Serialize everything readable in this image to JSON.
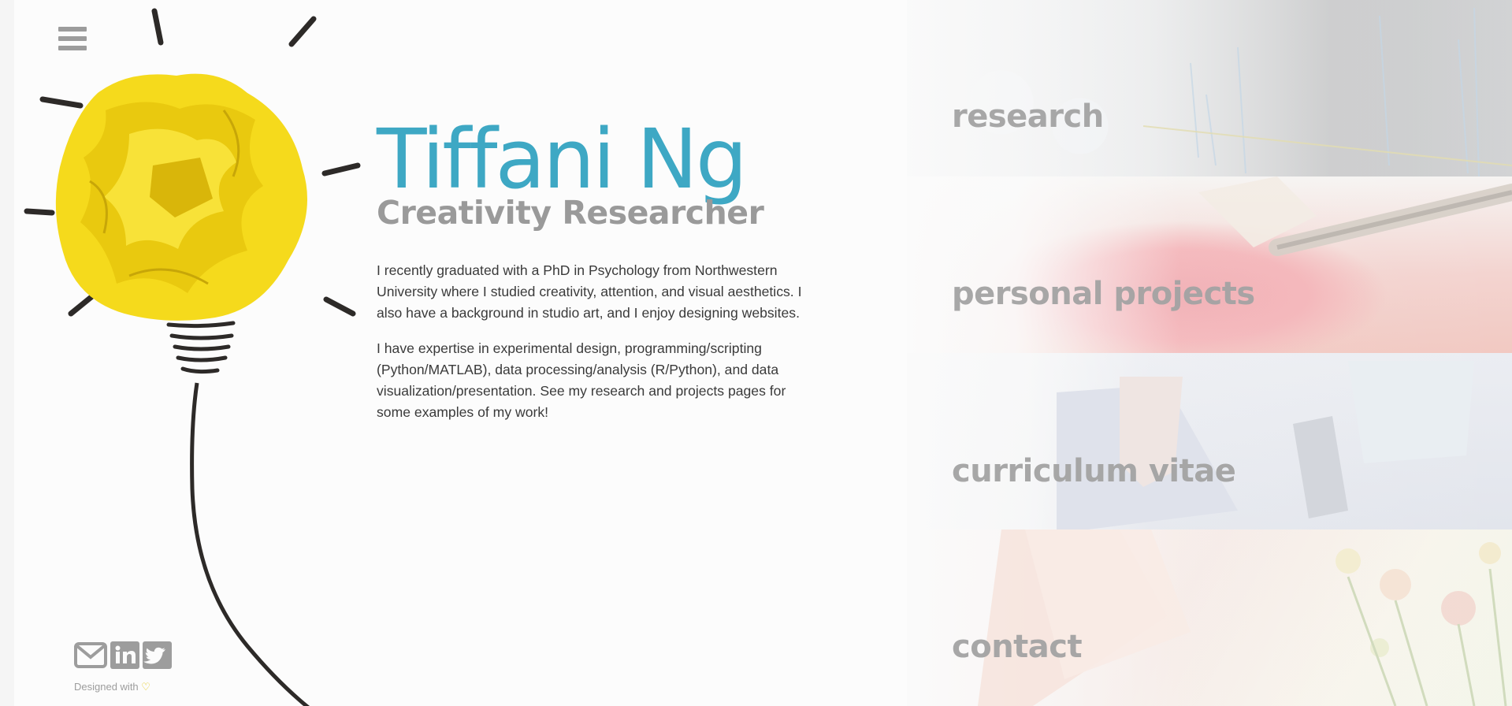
{
  "profile": {
    "name": "Tiffani Ng",
    "title": "Creativity Researcher",
    "bio": [
      "I recently graduated with a PhD in Psychology from Northwestern University where I studied creativity, attention, and visual aesthetics. I also have a background in studio art, and I enjoy designing websites.",
      "I have expertise in experimental design, programming/scripting (Python/MATLAB), data processing/analysis (R/Python), and data visualization/presentation. See my research and projects pages for some examples of my work!"
    ]
  },
  "nav": {
    "tiles": [
      {
        "label": "research"
      },
      {
        "label": "personal projects"
      },
      {
        "label": "curriculum vitae"
      },
      {
        "label": "contact"
      }
    ]
  },
  "footer": {
    "credit_text": "Designed with",
    "heart_icon": "heart-icon",
    "social_icons": [
      "envelope-icon",
      "linkedin-icon",
      "twitter-icon"
    ]
  },
  "colors": {
    "accent": "#3ea8c4",
    "subtitle": "#9a9a9a",
    "bulb": "#f3d718",
    "heart": "#e3c614"
  }
}
